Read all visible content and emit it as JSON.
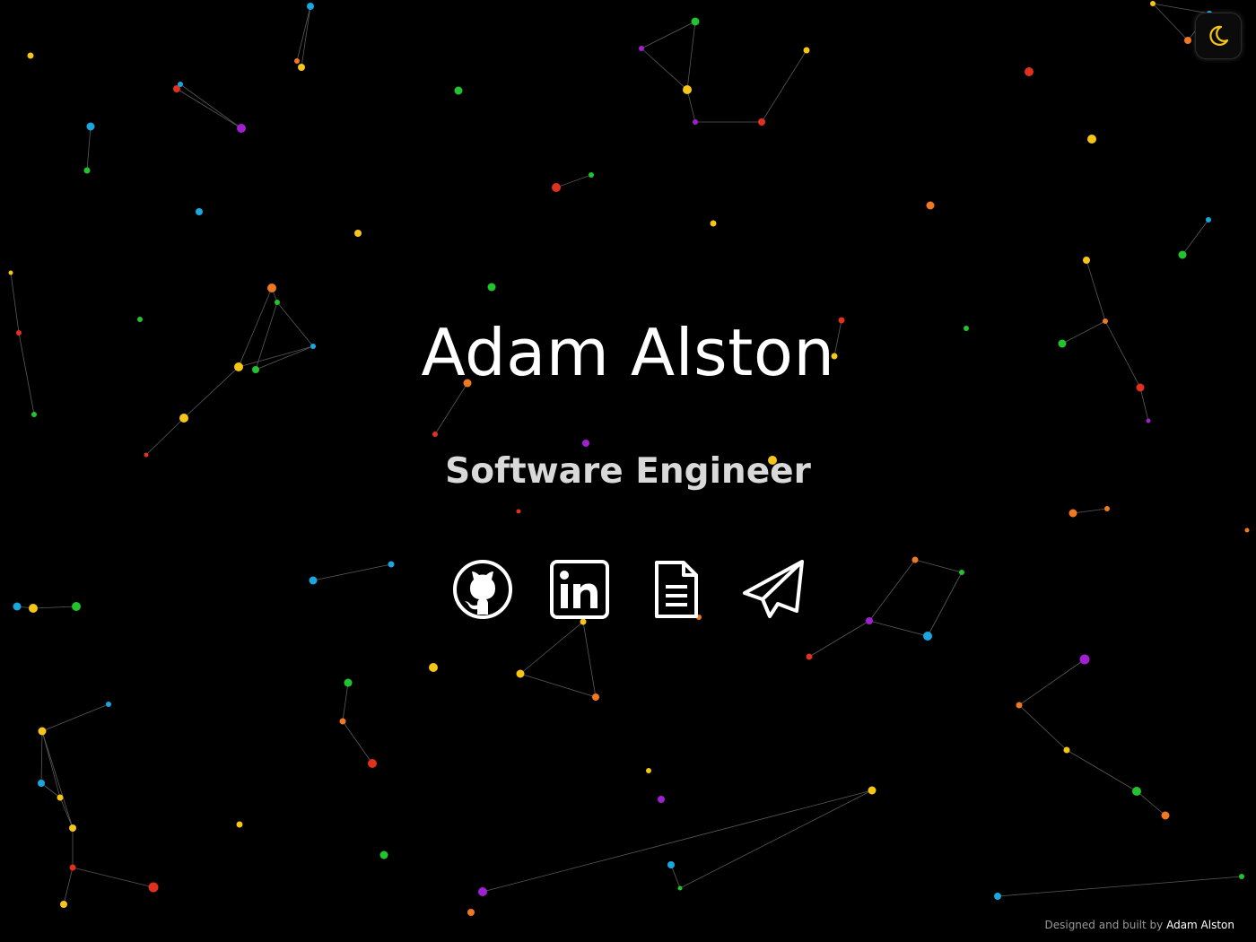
{
  "hero": {
    "name": "Adam Alston",
    "role": "Software Engineer"
  },
  "social_links": [
    {
      "name": "github-link",
      "icon": "github-icon"
    },
    {
      "name": "linkedin-link",
      "icon": "linkedin-icon"
    },
    {
      "name": "resume-link",
      "icon": "document-icon"
    },
    {
      "name": "contact-link",
      "icon": "paper-plane-icon"
    }
  ],
  "theme_toggle": {
    "icon": "moon-icon",
    "icon_color": "#f5c518"
  },
  "footer": {
    "prefix": "Designed and built by",
    "author": "Adam Alston"
  },
  "colors": {
    "background": "#000000",
    "text_primary": "#ffffff",
    "text_secondary": "#d9d9d9",
    "particle_palette": [
      "#f5c518",
      "#e0301e",
      "#22c32e",
      "#1aa7e0",
      "#a020d0",
      "#f07820"
    ]
  }
}
